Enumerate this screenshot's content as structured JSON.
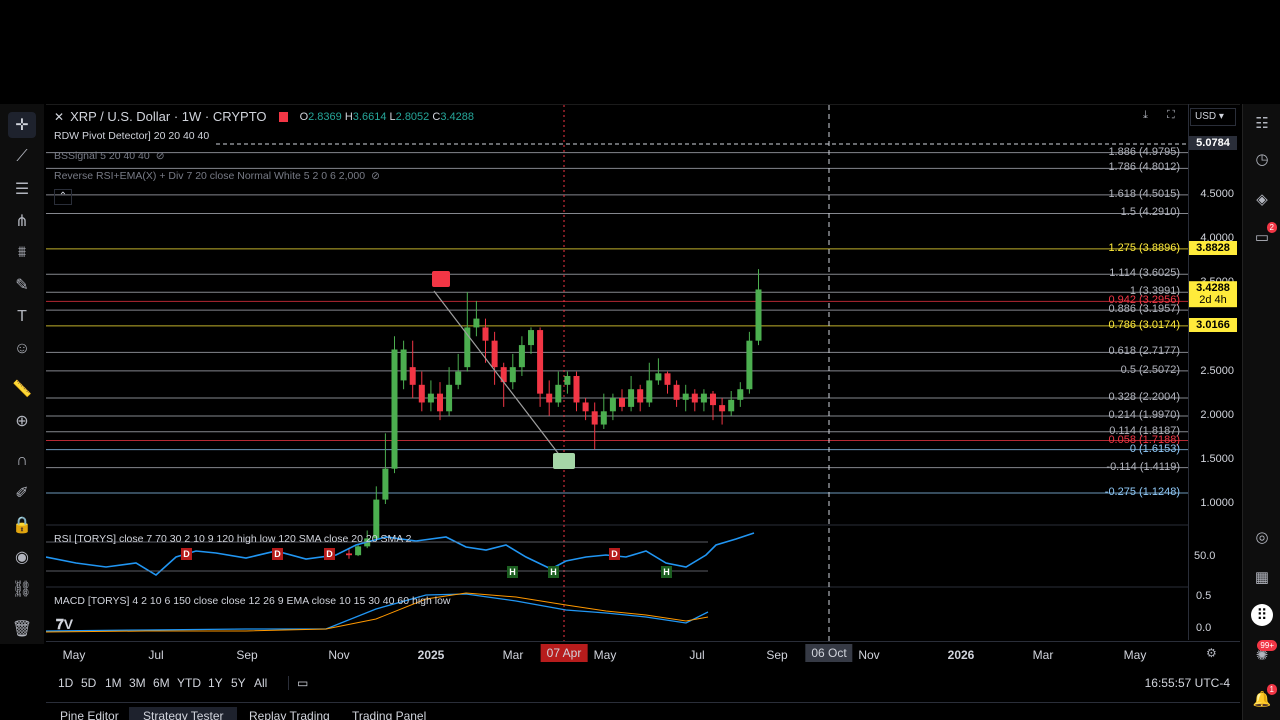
{
  "header": {
    "symbol_title": "XRP / U.S. Dollar · 1W · CRYPTO",
    "ohlc": {
      "o_label": "O",
      "o": "2.8369",
      "h_label": "H",
      "h": "3.6614",
      "l_label": "L",
      "l": "2.8052",
      "c_label": "C",
      "c": "3.4288"
    },
    "currency": "USD"
  },
  "indicators": [
    {
      "title": "RDW Pivot Detector] 20 20 40 40"
    },
    {
      "title": "BSSignal 5 20 40 40"
    },
    {
      "title": "Reverse RSI+EMA(X) + Div 7 20 close Normal White 5 2 0 6 2,000"
    }
  ],
  "fib_levels": [
    {
      "label": "1.886 (4.9795)",
      "price": 4.9795,
      "color": "#b2b5be"
    },
    {
      "label": "1.786 (4.8012)",
      "price": 4.8012,
      "color": "#b2b5be"
    },
    {
      "label": "1.618 (4.5015)",
      "price": 4.5015,
      "color": "#b2b5be"
    },
    {
      "label": "1.5 (4.2910)",
      "price": 4.291,
      "color": "#b2b5be"
    },
    {
      "label": "1.275 (3.8896)",
      "price": 3.8896,
      "color": "#ffeb3b"
    },
    {
      "label": "1.114 (3.6025)",
      "price": 3.6025,
      "color": "#b2b5be"
    },
    {
      "label": "1 (3.3991)",
      "price": 3.3991,
      "color": "#b2b5be"
    },
    {
      "label": "0.942 (3.2956)",
      "price": 3.2956,
      "color": "#f23645"
    },
    {
      "label": "0.886 (3.1957)",
      "price": 3.1957,
      "color": "#b2b5be"
    },
    {
      "label": "0.786 (3.0174)",
      "price": 3.0174,
      "color": "#ffeb3b"
    },
    {
      "label": "0.618 (2.7177)",
      "price": 2.7177,
      "color": "#b2b5be"
    },
    {
      "label": "0.5 (2.5072)",
      "price": 2.5072,
      "color": "#b2b5be"
    },
    {
      "label": "0.328 (2.2004)",
      "price": 2.2004,
      "color": "#b2b5be"
    },
    {
      "label": "0.214 (1.9970)",
      "price": 1.997,
      "color": "#b2b5be"
    },
    {
      "label": "0.114 (1.8187)",
      "price": 1.8187,
      "color": "#b2b5be"
    },
    {
      "label": "0.058 (1.7188)",
      "price": 1.7188,
      "color": "#f23645"
    },
    {
      "label": "0 (1.6153)",
      "price": 1.6153,
      "color": "#90caf9"
    },
    {
      "label": "-0.114 (1.4119)",
      "price": 1.4119,
      "color": "#b2b5be"
    },
    {
      "label": "-0.275 (1.1248)",
      "price": 1.1248,
      "color": "#90caf9"
    }
  ],
  "price_scale": {
    "ticks": [
      "4.5000",
      "4.0000",
      "3.5000",
      "2.5000",
      "2.0000",
      "1.5000",
      "1.0000"
    ],
    "tick_values": [
      4.5,
      4.0,
      3.5,
      2.5,
      2.0,
      1.5,
      1.0
    ],
    "boxes": [
      {
        "label": "5.0784",
        "price": 5.0784,
        "bg": "#2a2e39",
        "fg": "#ffffff"
      },
      {
        "label": "3.8828",
        "price": 3.8828,
        "bg": "#ffeb3b",
        "fg": "#000000"
      },
      {
        "label": "3.4288",
        "price": 3.4288,
        "bg": "#ffeb3b",
        "fg": "#000000",
        "sub": "2d 4h"
      },
      {
        "label": "3.0166",
        "price": 3.0166,
        "bg": "#ffeb3b",
        "fg": "#000000"
      }
    ]
  },
  "rsi_panel": {
    "title": "RSI [TORYS] close 7 70 30 2 10 9 120 high low 120 SMA close 20 20 SMA 2",
    "scale": "50.0",
    "markers": [
      {
        "t": "D",
        "x": 0.29
      },
      {
        "t": "D",
        "x": 0.46
      },
      {
        "t": "D",
        "x": 1.0
      },
      {
        "t": "H",
        "x": 1.42
      },
      {
        "t": "H",
        "x": 1.49
      },
      {
        "t": "D",
        "x": 1.6
      },
      {
        "t": "H",
        "x": 1.7
      }
    ]
  },
  "macd_panel": {
    "title": "MACD [TORYS] 4 2 10 6 150 close close 12 26 9 EMA close 10 15 30 40 60 high low",
    "scale_top": "0.5",
    "scale_bottom": "0.0"
  },
  "time_axis": {
    "labels": [
      "May",
      "Jul",
      "Sep",
      "Nov",
      "2025",
      "Mar",
      "May",
      "Jul",
      "Sep",
      "Nov",
      "2026",
      "Mar",
      "May"
    ],
    "highlight_1": "07 Apr",
    "highlight_2": "06 Oct"
  },
  "range_buttons": [
    "1D",
    "5D",
    "1M",
    "3M",
    "6M",
    "YTD",
    "1Y",
    "5Y",
    "All"
  ],
  "clock": "16:55:57 UTC-4",
  "bottom_tabs": [
    "Pine Editor",
    "Strategy Tester",
    "Replay Trading",
    "Trading Panel"
  ],
  "active_tab": "Strategy Tester",
  "sidebar_badges": {
    "chat": "2",
    "notifications": "99+",
    "alerts": "1"
  },
  "colors": {
    "up": "#4caf50",
    "down": "#f23645",
    "fib_yellow": "#ffeb3b",
    "rsi_line": "#2196f3",
    "macd_signal": "#ff9800"
  },
  "candles": [
    [
      0.0,
      0.44,
      0.42,
      0.5,
      0.38
    ],
    [
      0.0,
      0.42,
      0.52,
      0.55,
      0.41
    ],
    [
      0.0,
      0.52,
      0.61,
      0.7,
      0.5
    ],
    [
      0.0,
      0.61,
      1.05,
      1.2,
      0.58
    ],
    [
      0.0,
      1.05,
      1.4,
      1.8,
      1.0
    ],
    [
      0.0,
      1.4,
      2.75,
      2.9,
      1.35
    ],
    [
      0.0,
      2.4,
      2.75,
      2.85,
      2.3
    ],
    [
      0.0,
      2.55,
      2.35,
      2.85,
      2.2
    ],
    [
      0.0,
      2.35,
      2.15,
      2.5,
      2.05
    ],
    [
      0.0,
      2.15,
      2.25,
      2.4,
      2.05
    ],
    [
      0.0,
      2.25,
      2.05,
      2.38,
      1.95
    ],
    [
      0.0,
      2.05,
      2.35,
      2.55,
      2.0
    ],
    [
      0.0,
      2.35,
      2.5,
      2.7,
      2.3
    ],
    [
      0.0,
      2.55,
      3.0,
      3.4,
      2.5
    ],
    [
      0.0,
      3.0,
      3.1,
      3.3,
      2.9
    ],
    [
      0.0,
      3.0,
      2.85,
      3.1,
      2.6
    ],
    [
      0.0,
      2.85,
      2.55,
      2.95,
      2.35
    ],
    [
      0.0,
      2.55,
      2.38,
      2.6,
      2.1
    ],
    [
      0.0,
      2.38,
      2.55,
      2.7,
      2.3
    ],
    [
      0.0,
      2.55,
      2.8,
      2.9,
      2.45
    ],
    [
      0.0,
      2.8,
      2.97,
      3.0,
      2.7
    ],
    [
      0.0,
      2.97,
      2.25,
      3.0,
      2.1
    ],
    [
      0.0,
      2.25,
      2.15,
      2.4,
      2.0
    ],
    [
      0.0,
      2.15,
      2.35,
      2.5,
      2.1
    ],
    [
      0.0,
      2.35,
      2.45,
      2.5,
      2.25
    ],
    [
      0.0,
      2.45,
      2.15,
      2.5,
      2.05
    ],
    [
      0.0,
      2.15,
      2.05,
      2.2,
      1.95
    ],
    [
      0.0,
      2.05,
      1.9,
      2.15,
      1.62
    ],
    [
      0.0,
      1.9,
      2.05,
      2.25,
      1.85
    ],
    [
      0.0,
      2.05,
      2.2,
      2.25,
      1.95
    ],
    [
      0.0,
      2.2,
      2.1,
      2.3,
      2.05
    ],
    [
      0.0,
      2.1,
      2.3,
      2.45,
      2.05
    ],
    [
      0.0,
      2.3,
      2.15,
      2.35,
      2.05
    ],
    [
      0.0,
      2.15,
      2.4,
      2.6,
      2.1
    ],
    [
      0.0,
      2.4,
      2.48,
      2.65,
      2.35
    ],
    [
      0.0,
      2.48,
      2.35,
      2.5,
      2.25
    ],
    [
      0.0,
      2.35,
      2.18,
      2.4,
      2.1
    ],
    [
      0.0,
      2.18,
      2.25,
      2.35,
      2.05
    ],
    [
      0.0,
      2.25,
      2.15,
      2.3,
      2.05
    ],
    [
      0.0,
      2.15,
      2.25,
      2.3,
      2.05
    ],
    [
      0.0,
      2.25,
      2.12,
      2.28,
      1.95
    ],
    [
      0.0,
      2.12,
      2.05,
      2.2,
      1.9
    ],
    [
      0.0,
      2.05,
      2.18,
      2.28,
      2.0
    ],
    [
      0.0,
      2.18,
      2.3,
      2.38,
      2.1
    ],
    [
      0.0,
      2.3,
      2.85,
      2.95,
      2.25
    ],
    [
      0.0,
      2.85,
      3.43,
      3.66,
      2.8
    ]
  ]
}
